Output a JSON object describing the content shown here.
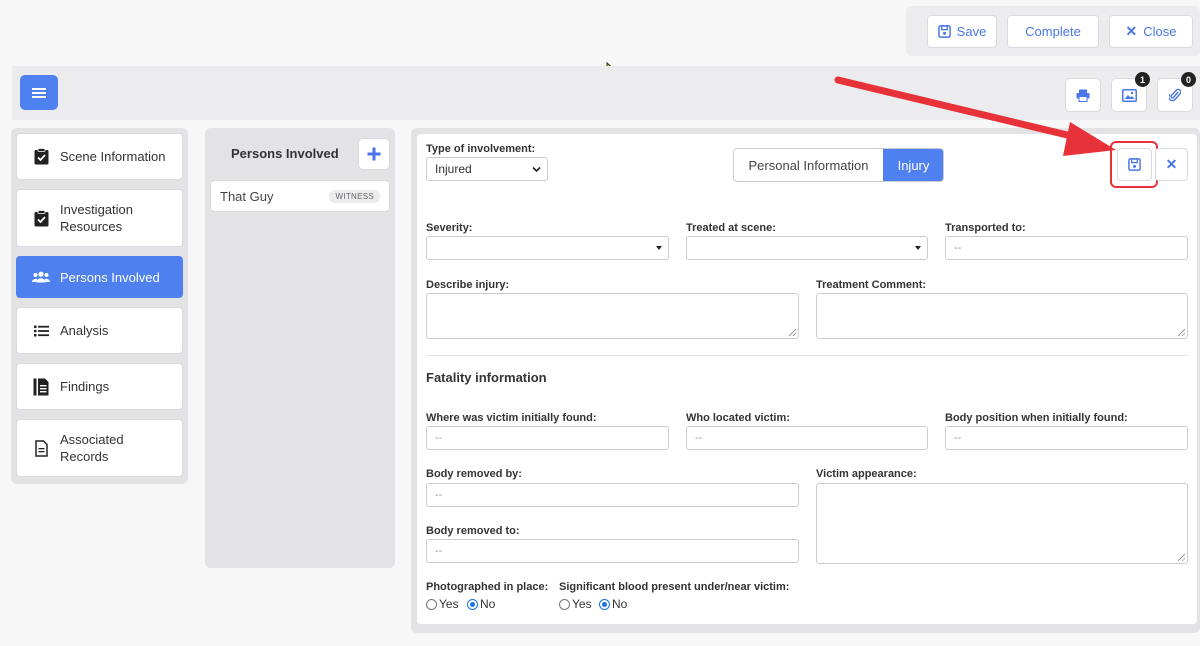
{
  "toolbar": {
    "save_label": "Save",
    "complete_label": "Complete",
    "close_label": "Close",
    "images_badge": "1",
    "attachments_badge": "0"
  },
  "sidebar": {
    "items": [
      {
        "label": "Scene Information",
        "icon": "clipboard-check-icon"
      },
      {
        "label": "Investigation Resources",
        "icon": "clipboard-check-icon"
      },
      {
        "label": "Persons Involved",
        "icon": "users-icon",
        "active": true
      },
      {
        "label": "Analysis",
        "icon": "list-icon"
      },
      {
        "label": "Findings",
        "icon": "document-list-icon"
      },
      {
        "label": "Associated Records",
        "icon": "file-icon"
      }
    ]
  },
  "persons": {
    "title": "Persons Involved",
    "list": [
      {
        "name": "That Guy",
        "role": "WITNESS"
      }
    ]
  },
  "form": {
    "involvement_label": "Type of involvement:",
    "involvement_value": "Injured",
    "tabs": [
      "Personal Information",
      "Injury"
    ],
    "active_tab": "Injury",
    "severity_label": "Severity:",
    "treated_label": "Treated at scene:",
    "transported_label": "Transported to:",
    "transported_value": "--",
    "describe_label": "Describe injury:",
    "treatment_comment_label": "Treatment Comment:",
    "fatality_heading": "Fatality information",
    "victim_found_label": "Where was victim initially found:",
    "victim_found_value": "--",
    "located_by_label": "Who located victim:",
    "located_by_value": "--",
    "body_position_label": "Body position when initially found:",
    "body_position_value": "--",
    "removed_by_label": "Body removed by:",
    "removed_by_value": "--",
    "victim_appearance_label": "Victim appearance:",
    "removed_to_label": "Body removed to:",
    "removed_to_value": "--",
    "photographed_label": "Photographed in place:",
    "blood_label": "Significant blood present under/near victim:",
    "yes_label": "Yes",
    "no_label": "No",
    "photographed_selected": "No",
    "blood_selected": "No"
  },
  "colors": {
    "accent": "#4f80f0",
    "annotation": "#e8323a"
  }
}
